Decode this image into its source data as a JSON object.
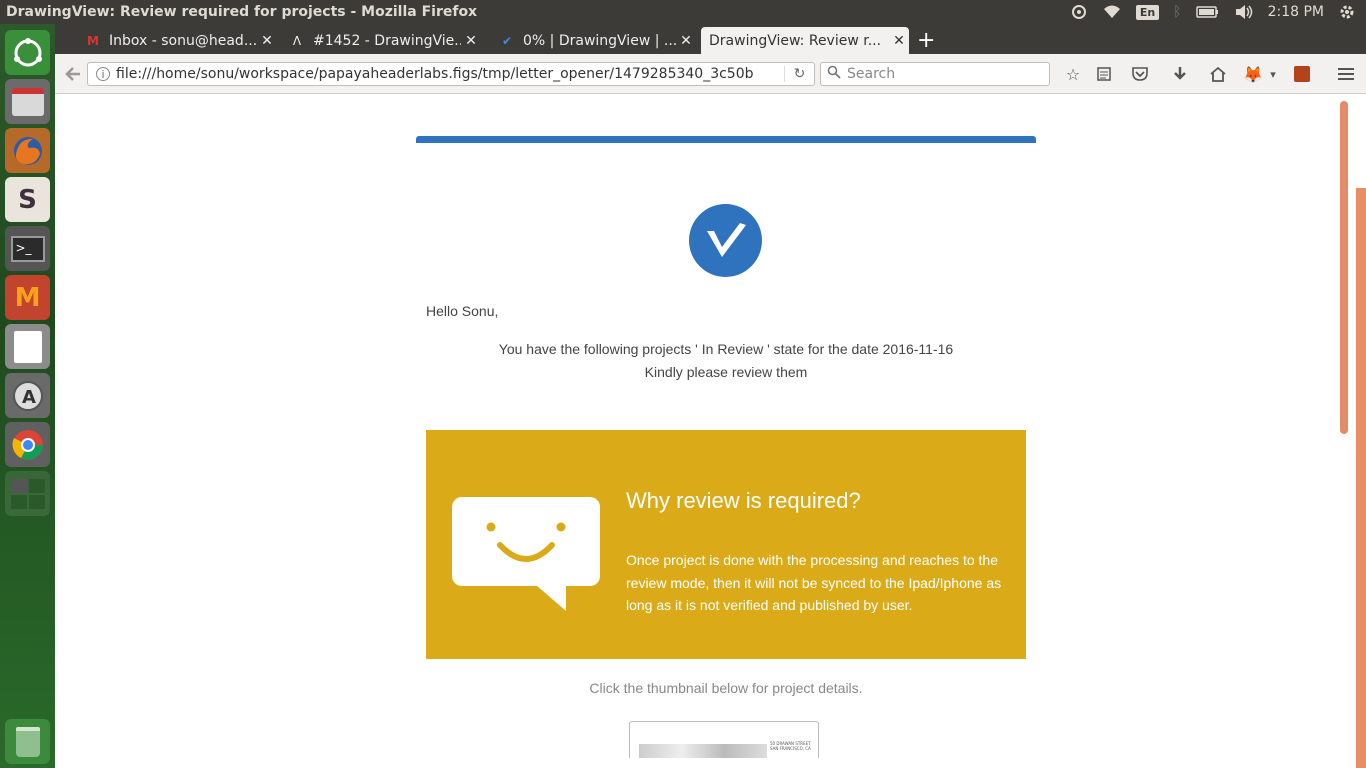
{
  "system": {
    "window_title": "DrawingView: Review required for projects - Mozilla Firefox",
    "lang": "En",
    "time": "2:18 PM"
  },
  "launcher": {
    "apps": [
      "ubuntu-dash-icon",
      "files-icon",
      "firefox-icon",
      "slack-icon",
      "terminal-icon",
      "mendeley-icon",
      "text-editor-icon",
      "software-updater-icon",
      "chrome-icon",
      "workspace-switcher-icon",
      "trash-icon"
    ]
  },
  "tabs": [
    {
      "label": "Inbox - sonu@head...",
      "icon": "M"
    },
    {
      "label": "#1452 - DrawingVie...",
      "icon": "Λ"
    },
    {
      "label": "0% | DrawingView | ...",
      "icon": "✔"
    },
    {
      "label": "DrawingView: Review r...",
      "icon": ""
    }
  ],
  "nav": {
    "url": "file:///home/sonu/workspace/papayaheaderlabs.figs/tmp/letter_opener/1479285340_3c50b",
    "search_placeholder": "Search"
  },
  "email": {
    "greeting": "Hello Sonu,",
    "line1": "You have the following projects ' In Review ' state for the date 2016-11-16",
    "line2": "Kindly please review them",
    "box_title": "Why review is required?",
    "box_text": "Once project is done with the processing and reaches to the review mode, then it will not be synced to the Ipad/Iphone as long as it is not verified and published by user.",
    "click_note": "Click the thumbnail below for project details.",
    "thumb_text": "50 DRAWAN STREET SAN FRANCISCO, CA"
  },
  "colors": {
    "brand_blue": "#2f72bd",
    "callout_yellow": "#dbaa19",
    "scroll_orange": "#e48c68"
  }
}
